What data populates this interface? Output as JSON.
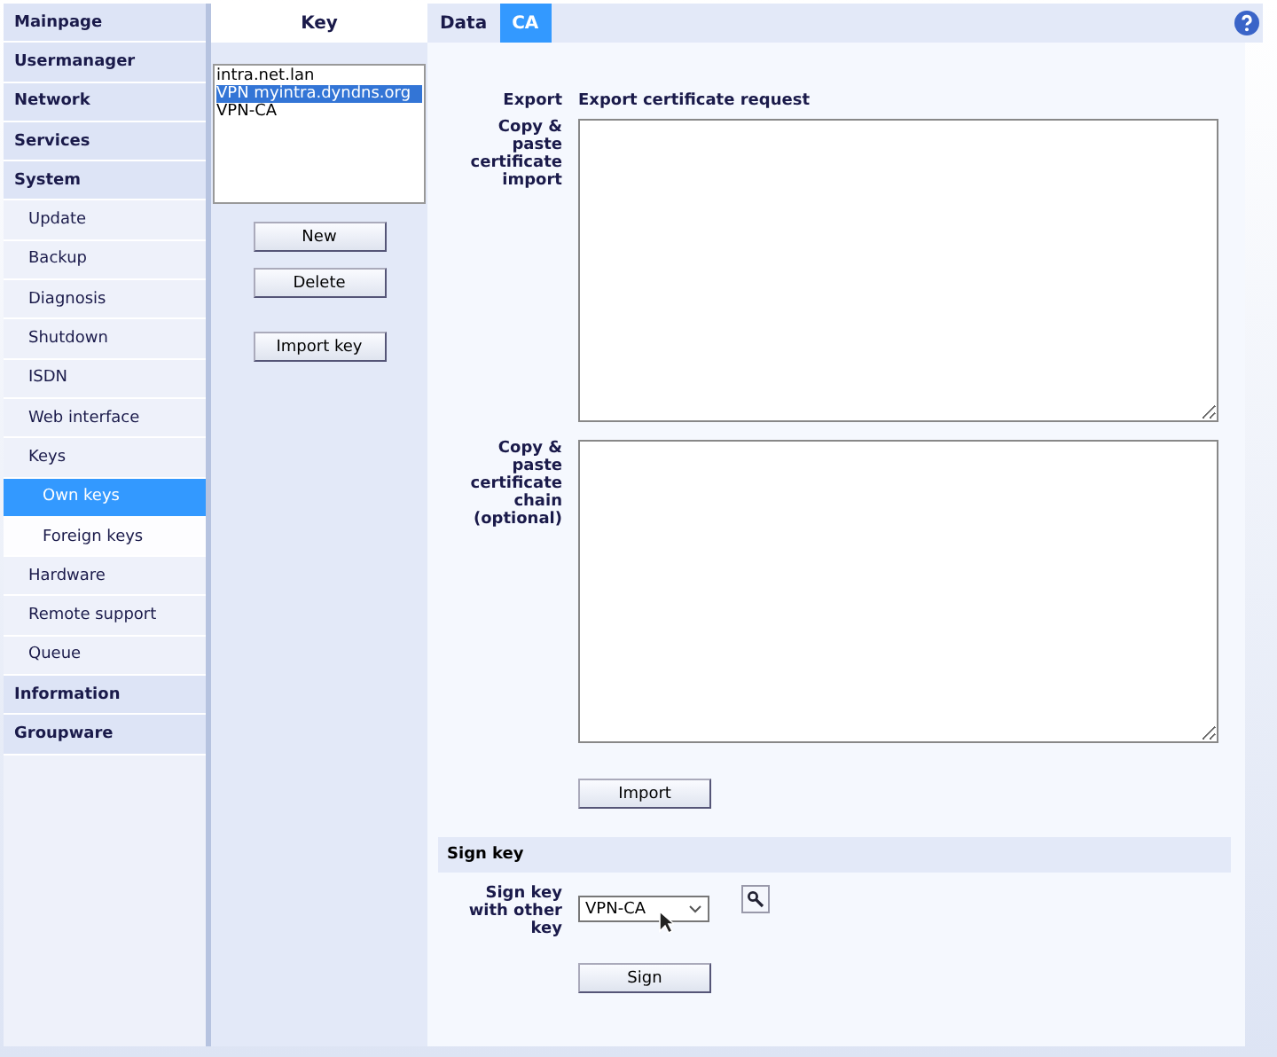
{
  "sidebar": {
    "items": [
      {
        "label": "Mainpage",
        "selected": false
      },
      {
        "label": "Usermanager",
        "selected": false
      },
      {
        "label": "Network",
        "selected": false
      },
      {
        "label": "Services",
        "selected": false
      },
      {
        "label": "System",
        "selected": false,
        "children": [
          {
            "label": "Update",
            "selected": false
          },
          {
            "label": "Backup",
            "selected": false
          },
          {
            "label": "Diagnosis",
            "selected": false
          },
          {
            "label": "Shutdown",
            "selected": false
          },
          {
            "label": "ISDN",
            "selected": false
          },
          {
            "label": "Web interface",
            "selected": false
          },
          {
            "label": "Keys",
            "selected": false,
            "children": [
              {
                "label": "Own keys",
                "selected": true
              },
              {
                "label": "Foreign keys",
                "selected": false
              }
            ]
          },
          {
            "label": "Hardware",
            "selected": false
          },
          {
            "label": "Remote support",
            "selected": false
          },
          {
            "label": "Queue",
            "selected": false
          }
        ]
      },
      {
        "label": "Information",
        "selected": false
      },
      {
        "label": "Groupware",
        "selected": false
      }
    ]
  },
  "key_panel": {
    "title": "Key",
    "keys": [
      {
        "label": "intra.net.lan",
        "selected": false
      },
      {
        "label": "VPN myintra.dyndns.org",
        "selected": true
      },
      {
        "label": "VPN-CA",
        "selected": false
      }
    ],
    "buttons": [
      "New",
      "Delete",
      "Import key"
    ]
  },
  "tabs": [
    {
      "label": "Data",
      "selected": false
    },
    {
      "label": "CA",
      "selected": true
    }
  ],
  "form": {
    "export_label": "Export",
    "export_link": "Export certificate request",
    "import_label": "Copy & paste certificate import",
    "chain_label": "Copy & paste certificate chain (optional)",
    "import_button": "Import",
    "sign_section": "Sign key",
    "sign_label": "Sign key with other key",
    "sign_select": "VPN-CA",
    "sign_button": "Sign"
  }
}
